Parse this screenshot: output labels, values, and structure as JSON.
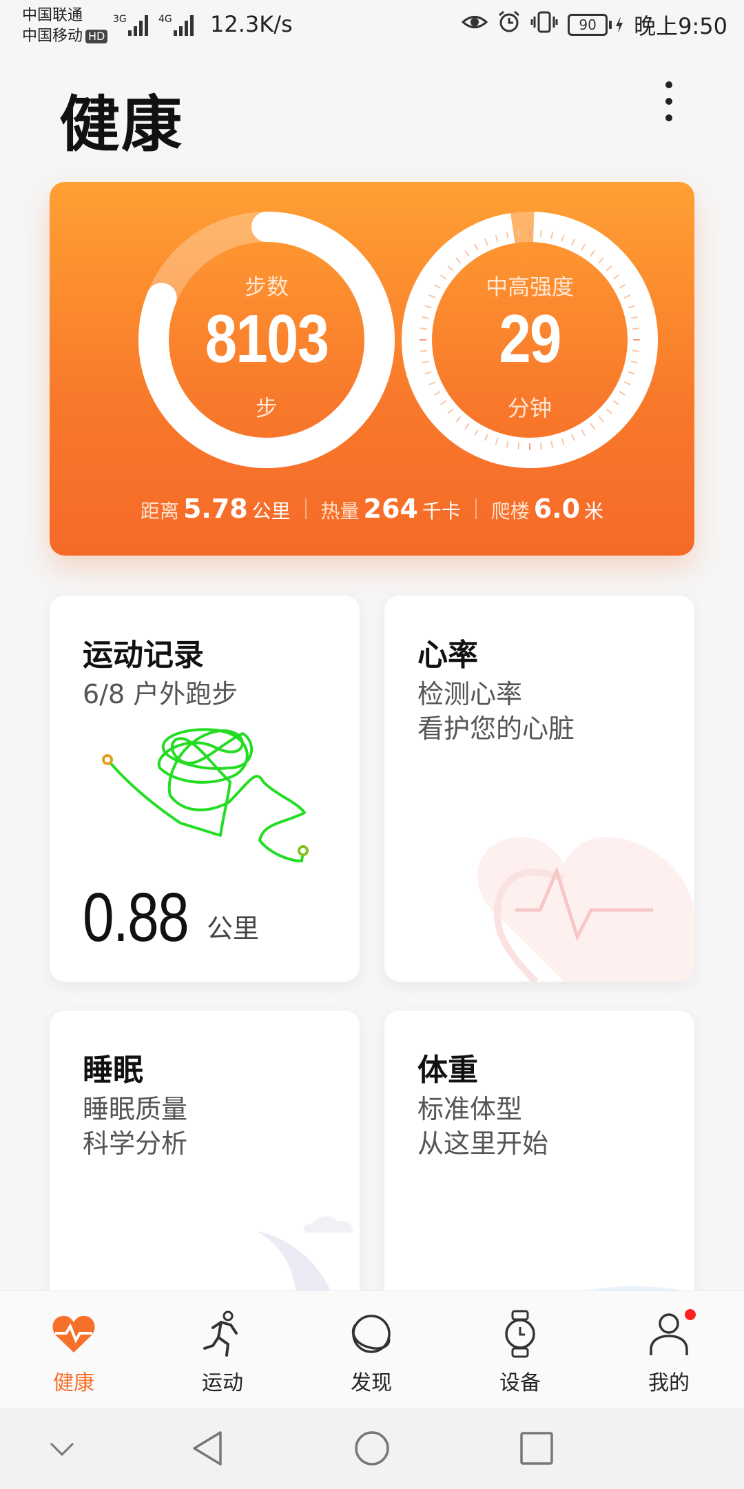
{
  "status_bar": {
    "carrier1": "中国联通",
    "carrier2": "中国移动",
    "hd": "HD",
    "net1": "3G",
    "net2": "4G",
    "speed": "12.3K/s",
    "battery": "90",
    "time": "晚上9:50"
  },
  "header": {
    "title": "健康"
  },
  "summary": {
    "steps": {
      "label": "步数",
      "value": "8103",
      "unit": "步",
      "progress": 0.81
    },
    "intensity": {
      "label": "中高强度",
      "value": "29",
      "unit": "分钟",
      "progress": 0.97
    },
    "stats": [
      {
        "label": "距离",
        "value": "5.78",
        "unit": "公里"
      },
      {
        "label": "热量",
        "value": "264",
        "unit": "千卡"
      },
      {
        "label": "爬楼",
        "value": "6.0",
        "unit": "米"
      }
    ]
  },
  "cards": {
    "exercise": {
      "title": "运动记录",
      "subtitle": "6/8 户外跑步",
      "distance": "0.88",
      "unit": "公里"
    },
    "heart": {
      "title": "心率",
      "line1": "检测心率",
      "line2": "看护您的心脏"
    },
    "sleep": {
      "title": "睡眠",
      "line1": "睡眠质量",
      "line2": "科学分析"
    },
    "weight": {
      "title": "体重",
      "line1": "标准体型",
      "line2": "从这里开始"
    }
  },
  "tabs": [
    {
      "label": "健康",
      "icon": "heart-pulse-icon",
      "active": true
    },
    {
      "label": "运动",
      "icon": "runner-icon"
    },
    {
      "label": "发现",
      "icon": "planet-icon"
    },
    {
      "label": "设备",
      "icon": "watch-icon"
    },
    {
      "label": "我的",
      "icon": "person-icon",
      "badge": true
    }
  ],
  "colors": {
    "accent": "#f6702a",
    "hero_top": "#ffa033",
    "hero_bottom": "#f56a28",
    "route": "#22dd22",
    "badge": "#ff2222"
  }
}
